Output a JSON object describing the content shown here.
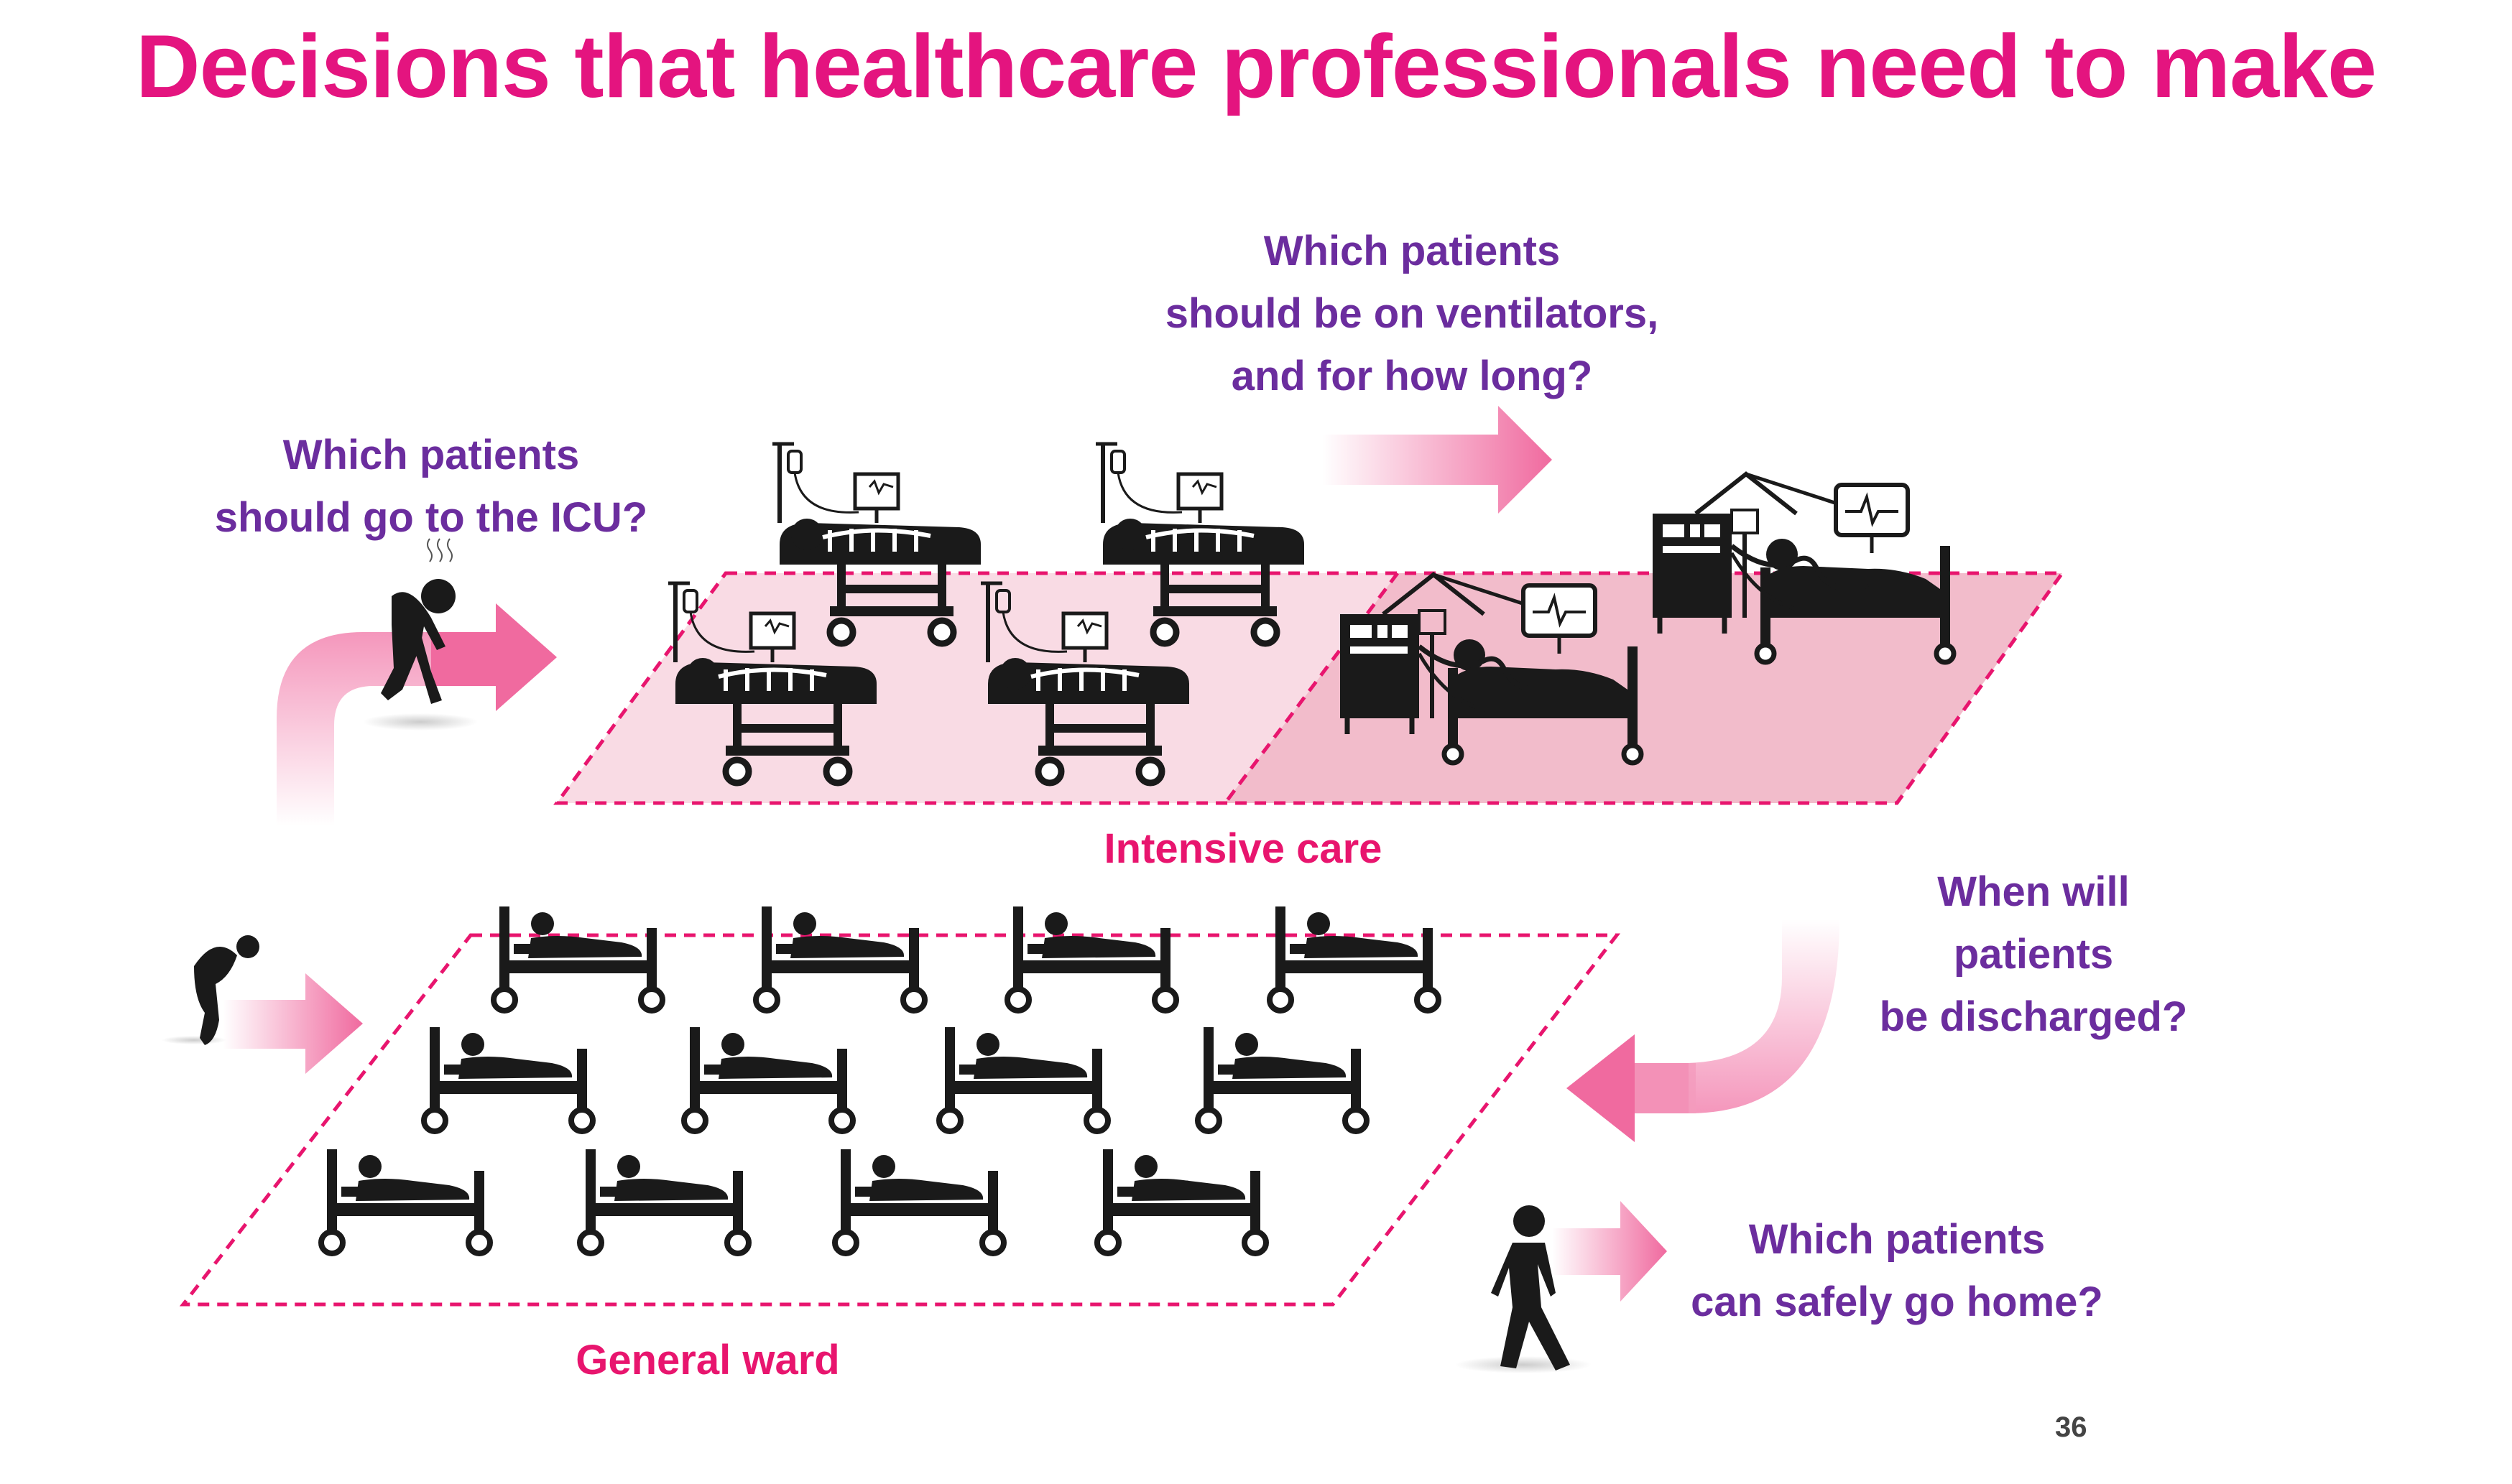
{
  "slide": {
    "title": "Decisions that healthcare professionals need to make",
    "page_number": "36"
  },
  "questions": {
    "icu_line1": "Which patients",
    "icu_line2": "should go to the ICU?",
    "vent_line1": "Which patients",
    "vent_line2": "should be on ventilators,",
    "vent_line3": "and for  how long?",
    "discharge_line1": "When will",
    "discharge_line2": "patients",
    "discharge_line3": "be discharged?",
    "home_line1": "Which patients",
    "home_line2": "can safely go home?"
  },
  "zones": {
    "intensive_care": "Intensive care",
    "general_ward": "General ward"
  },
  "colors": {
    "title": "#e4147f",
    "question_text": "#6b2d9e",
    "zone_label": "#e8156e",
    "zone_border": "#e8156e",
    "icu_fill_light": "#f9dbe4",
    "icu_fill_dark": "#f2bccb",
    "arrow": "#f06a9f",
    "icon": "#1a1a1a"
  },
  "icons": {
    "sick_person": "sick-person-icon",
    "bent_person": "bent-person-icon",
    "walking_person": "walking-person-icon",
    "icu_bed": "icu-bed-icon",
    "ventilator_bed": "ventilator-bed-icon",
    "ward_bed": "ward-bed-icon"
  }
}
